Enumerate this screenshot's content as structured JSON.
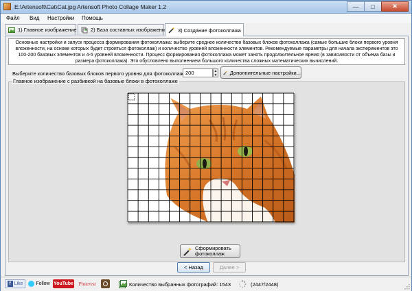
{
  "window": {
    "title": "E:\\Artensoft\\Cat\\Cat.jpg Artensoft Photo Collage Maker 1.2"
  },
  "menu": [
    "Файл",
    "Вид",
    "Настройки",
    "Помощь"
  ],
  "tabs": [
    {
      "label": "1) Главное изображение",
      "icon": "image-icon",
      "active": false
    },
    {
      "label": "2) База составных изображений",
      "icon": "database-icon",
      "active": false
    },
    {
      "label": "3) Создание фотоколлажа",
      "icon": "magic-wand-icon",
      "active": true
    }
  ],
  "description": "Основные настройки и запуск процесса формирования фотоколлажа: выберите среднее количество базовых блоков фотоколлажа (самые большие блоки первого уровня вложенности, на основе которых будет строиться фотоколлаж) и количество уровней вложенности элементов. Рекомендуемые параметры для начала экспериментов это 100-200 базовых элементов и 4-5 уровней вложенности. Процесс формирования фотоколлажа может занять продолжительное время (в зависимости от объема базы и размера фотоколлажа). Это обусловлено выполнением большого количества сложных математических вычислений.",
  "settings": {
    "count_label": "Выберите количество базовых блоков первого уровня для фотоколлажа:",
    "count_value": "200",
    "advanced_button": "Дополнительные настройки..."
  },
  "preview": {
    "group_label": "Главное изображение с разбивкой на базовые блоки в фотоколлаже",
    "grid_columns": 16,
    "grid_rows": 12
  },
  "actions": {
    "make_line1": "Сформировать",
    "make_line2": "фотоколлаж",
    "back": "< Назад",
    "next": "Далее >"
  },
  "status": {
    "social": {
      "like": "Like",
      "follow": "Follow",
      "youtube": "YouTube",
      "pinterest": "Pinterest"
    },
    "selected_label": "Количество выбранных фотографий: 1543",
    "progress": "(2447/2448)"
  },
  "colors": {
    "title_bar": "#b9d3ee",
    "close_button": "#c64b30",
    "cat_orange": "#d9782a",
    "grid_line": "#000000",
    "facebook": "#3b5998",
    "twitter": "#33ccff",
    "youtube": "#cc181e",
    "pinterest": "#cb2027"
  }
}
